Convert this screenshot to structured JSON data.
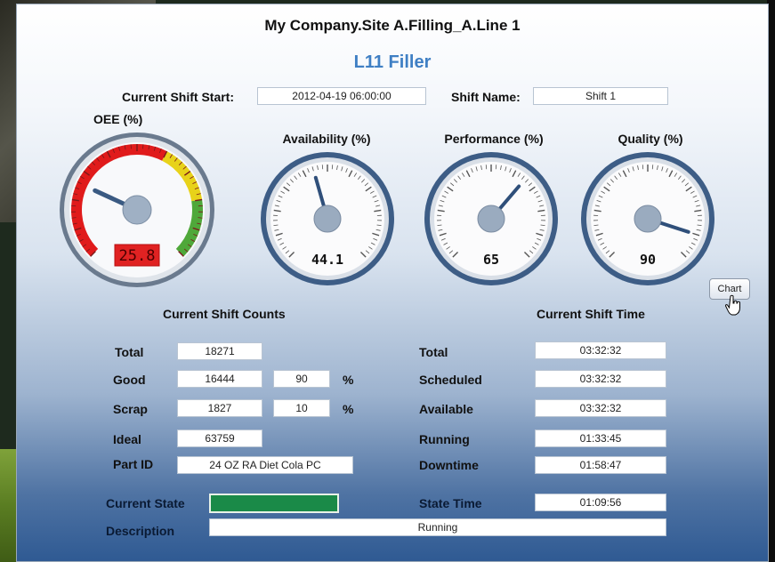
{
  "header": {
    "title": "My Company.Site A.Filling_A.Line 1",
    "subtitle": "L11 Filler"
  },
  "shift": {
    "start_label": "Current Shift Start:",
    "start_value": "2012-04-19 06:00:00",
    "name_label": "Shift Name:",
    "name_value": "Shift 1"
  },
  "gauges": {
    "oee": {
      "label": "OEE (%)",
      "value": "25.8",
      "value_num": 25.8
    },
    "availability": {
      "label": "Availability (%)",
      "value": "44.1",
      "value_num": 44.1
    },
    "performance": {
      "label": "Performance (%)",
      "value": "65",
      "value_num": 65
    },
    "quality": {
      "label": "Quality (%)",
      "value": "90",
      "value_num": 90
    }
  },
  "chart_button": {
    "label": "Chart"
  },
  "counts": {
    "heading": "Current Shift Counts",
    "total_label": "Total",
    "total": "18271",
    "good_label": "Good",
    "good": "16444",
    "good_pct": "90",
    "good_pct_unit": "%",
    "scrap_label": "Scrap",
    "scrap": "1827",
    "scrap_pct": "10",
    "scrap_pct_unit": "%",
    "ideal_label": "Ideal",
    "ideal": "63759",
    "part_label": "Part ID",
    "part": "24 OZ RA Diet Cola PC"
  },
  "time": {
    "heading": "Current Shift Time",
    "total_label": "Total",
    "total": "03:32:32",
    "scheduled_label": "Scheduled",
    "scheduled": "03:32:32",
    "available_label": "Available",
    "available": "03:32:32",
    "running_label": "Running",
    "running": "01:33:45",
    "downtime_label": "Downtime",
    "downtime": "01:58:47"
  },
  "state": {
    "current_label": "Current State",
    "current_color": "#1a8a48",
    "state_time_label": "State Time",
    "state_time": "01:09:56",
    "description_label": "Description",
    "description": "Running"
  },
  "colors": {
    "title_blue": "#3f7fc4",
    "oee_red": "#e01b1b",
    "oee_yellow": "#e8d21a",
    "oee_green": "#4fa83a"
  }
}
